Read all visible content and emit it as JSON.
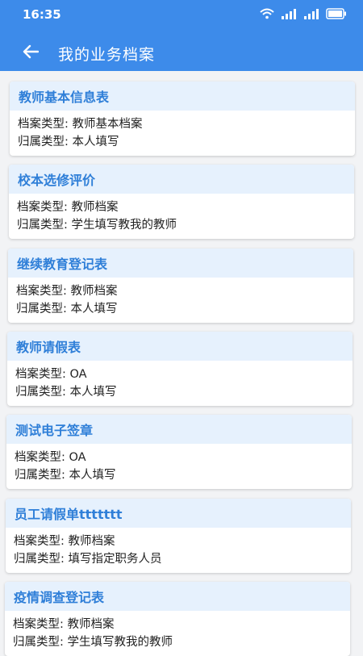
{
  "status_bar": {
    "time": "16:35",
    "icons": [
      "wifi-icon",
      "signal-icon",
      "signal-icon",
      "battery-icon"
    ]
  },
  "appbar": {
    "back_icon": "arrow-left-icon",
    "title": "我的业务档案"
  },
  "labels": {
    "type": "档案类型: ",
    "owner": "归属类型: "
  },
  "cards": [
    {
      "title": "教师基本信息表",
      "type": "教师基本档案",
      "owner": "本人填写"
    },
    {
      "title": "校本选修评价",
      "type": "教师档案",
      "owner": "学生填写教我的教师"
    },
    {
      "title": "继续教育登记表",
      "type": "教师档案",
      "owner": "本人填写"
    },
    {
      "title": "教师请假表",
      "type": "OA",
      "owner": "本人填写"
    },
    {
      "title": "测试电子签章",
      "type": "OA",
      "owner": "本人填写"
    },
    {
      "title": "员工请假单ttttttt",
      "type": "教师档案",
      "owner": "填写指定职务人员"
    },
    {
      "title": "疫情调查登记表",
      "type": "教师档案",
      "owner": "学生填写教我的教师"
    }
  ],
  "colors": {
    "header": "#3d8bea",
    "card_head_bg": "#e6f1fd",
    "card_title": "#2f7fd8"
  }
}
